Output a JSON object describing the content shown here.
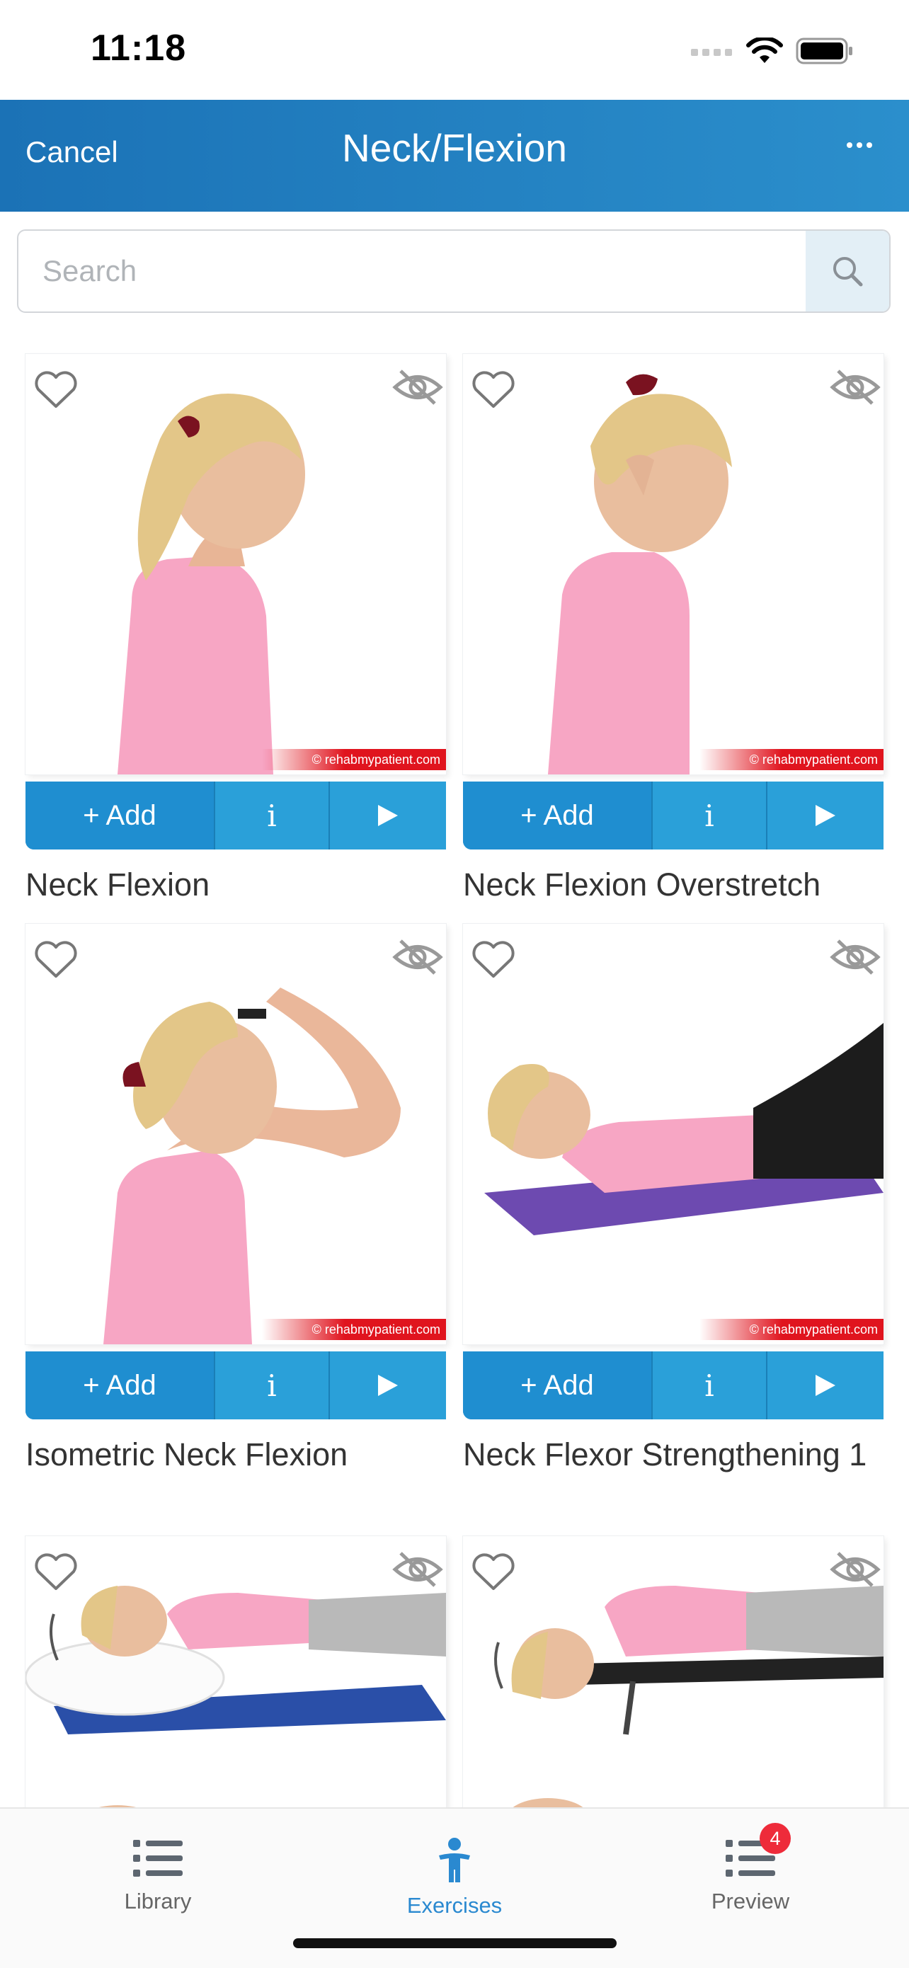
{
  "status_bar": {
    "time": "11:18"
  },
  "header": {
    "cancel_label": "Cancel",
    "title": "Neck/Flexion"
  },
  "search": {
    "placeholder": "Search"
  },
  "exercises": [
    {
      "name": "Neck Flexion",
      "add_label": "+ Add",
      "info_label": "i",
      "watermark": "© rehabmypatient.com"
    },
    {
      "name": "Neck Flexion Overstretch",
      "add_label": "+ Add",
      "info_label": "i",
      "watermark": "© rehabmypatient.com"
    },
    {
      "name": "Isometric Neck Flexion",
      "add_label": "+ Add",
      "info_label": "i",
      "watermark": "© rehabmypatient.com"
    },
    {
      "name": "Neck Flexor Strengthening 1",
      "add_label": "+ Add",
      "info_label": "i",
      "watermark": "© rehabmypatient.com"
    },
    {
      "name": ""
    },
    {
      "name": ""
    }
  ],
  "tabbar": {
    "library_label": "Library",
    "exercises_label": "Exercises",
    "preview_label": "Preview",
    "preview_badge": "4"
  },
  "colors": {
    "header": "#1f80c0",
    "accent": "#2397d2",
    "badge": "#ee2b3a",
    "active_tab": "#2a89d0"
  }
}
